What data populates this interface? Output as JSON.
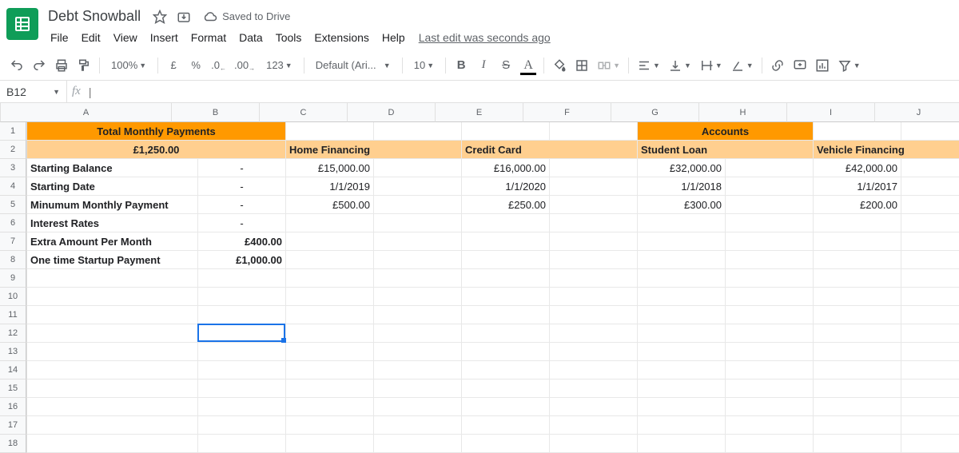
{
  "doc": {
    "title": "Debt Snowball",
    "save_status": "Saved to Drive",
    "last_edit": "Last edit was seconds ago"
  },
  "menus": [
    "File",
    "Edit",
    "View",
    "Insert",
    "Format",
    "Data",
    "Tools",
    "Extensions",
    "Help"
  ],
  "toolbar": {
    "zoom": "100%",
    "currency": "£",
    "percent": "%",
    "dec_dec": ".0",
    "dec_inc": ".00",
    "more_formats": "123",
    "font": "Default (Ari...",
    "font_size": "10"
  },
  "namebox": "B12",
  "fx_placeholder": "|",
  "col_widths": {
    "A": 214,
    "B": 110,
    "C": 110,
    "D": 110,
    "E": 110,
    "F": 110,
    "G": 110,
    "H": 110,
    "I": 110,
    "J": 110
  },
  "columns": [
    "A",
    "B",
    "C",
    "D",
    "E",
    "F",
    "G",
    "H",
    "I",
    "J"
  ],
  "row_count": 18,
  "cells": {
    "r1": {
      "A": {
        "text": "Total Monthly Payments",
        "span": 2,
        "cls": "orange-dark bold center"
      },
      "G": {
        "text": "Accounts",
        "span": 2,
        "cls": "orange-dark bold center"
      }
    },
    "r2": {
      "A": {
        "text": "£1,250.00",
        "span": 2,
        "cls": "orange-light bold center"
      },
      "C": {
        "text": "Home Financing",
        "span": 2,
        "cls": "orange-light bold"
      },
      "E": {
        "text": "Credit Card",
        "span": 2,
        "cls": "orange-light bold"
      },
      "G": {
        "text": "Student Loan",
        "span": 2,
        "cls": "orange-light bold"
      },
      "I": {
        "text": "Vehicle Financing",
        "span": 2,
        "cls": "orange-light bold"
      }
    },
    "r3": {
      "A": {
        "text": "Starting Balance",
        "cls": "bold"
      },
      "B": {
        "text": "-",
        "cls": "center"
      },
      "C": {
        "text": "£15,000.00",
        "cls": "right"
      },
      "E": {
        "text": "£16,000.00",
        "cls": "right"
      },
      "G": {
        "text": "£32,000.00",
        "cls": "right"
      },
      "I": {
        "text": "£42,000.00",
        "cls": "right"
      }
    },
    "r4": {
      "A": {
        "text": "Starting Date",
        "cls": "bold"
      },
      "B": {
        "text": "-",
        "cls": "center"
      },
      "C": {
        "text": "1/1/2019",
        "cls": "right"
      },
      "E": {
        "text": "1/1/2020",
        "cls": "right"
      },
      "G": {
        "text": "1/1/2018",
        "cls": "right"
      },
      "I": {
        "text": "1/1/2017",
        "cls": "right"
      }
    },
    "r5": {
      "A": {
        "text": "Minumum Monthly Payment",
        "cls": "bold"
      },
      "B": {
        "text": "-",
        "cls": "center"
      },
      "C": {
        "text": "£500.00",
        "cls": "right"
      },
      "E": {
        "text": "£250.00",
        "cls": "right"
      },
      "G": {
        "text": "£300.00",
        "cls": "right"
      },
      "I": {
        "text": "£200.00",
        "cls": "right"
      }
    },
    "r6": {
      "A": {
        "text": "Interest Rates",
        "cls": "bold"
      },
      "B": {
        "text": "-",
        "cls": "center"
      }
    },
    "r7": {
      "A": {
        "text": "Extra Amount Per Month",
        "cls": "bold"
      },
      "B": {
        "text": "£400.00",
        "cls": "bold right"
      }
    },
    "r8": {
      "A": {
        "text": "One time Startup Payment",
        "cls": "bold"
      },
      "B": {
        "text": "£1,000.00",
        "cls": "bold right"
      }
    }
  },
  "selection": {
    "col": "B",
    "row": 12
  }
}
